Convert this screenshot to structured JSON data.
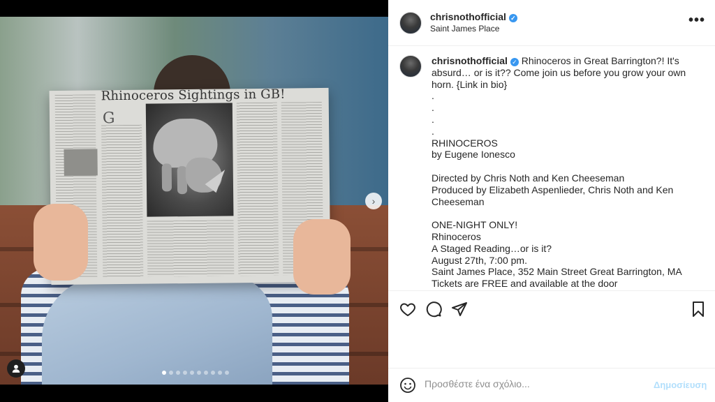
{
  "post": {
    "username": "chrisnothofficial",
    "location": "Saint James Place",
    "more_label": "•••",
    "verified_glyph": "✓"
  },
  "media": {
    "newspaper_headline": "Rhinoceros Sightings in GB!",
    "dropcap": "G",
    "next_glyph": "›",
    "carousel_count": 10,
    "carousel_active": 0
  },
  "caption": {
    "username": "chrisnothofficial",
    "intro": " Rhinoceros in Great Barrington?! It's absurd… or is it?? Come join us before you grow your own horn. {Link in bio}",
    "lines": [
      ".",
      ".",
      ".",
      ".",
      "RHINOCEROS",
      "by Eugene Ionesco",
      "",
      "Directed by Chris Noth and Ken Cheeseman",
      "Produced by Elizabeth Aspenlieder, Chris Noth and Ken Cheeseman",
      "",
      "ONE-NIGHT ONLY!",
      "Rhinoceros",
      "A Staged Reading…or is it?",
      "August 27th, 7:00 pm.",
      "Saint James Place, 352 Main Street Great Barrington, MA",
      "Tickets are FREE and available at the door"
    ]
  },
  "actions": {
    "icons": [
      "heart-icon",
      "comment-icon",
      "share-icon",
      "bookmark-icon"
    ]
  },
  "comment": {
    "placeholder": "Προσθέστε ένα σχόλιο...",
    "post_label": "Δημοσίευση",
    "post_color": "#b2dffc"
  },
  "colors": {
    "verified": "#3897f0",
    "text": "#262626"
  }
}
